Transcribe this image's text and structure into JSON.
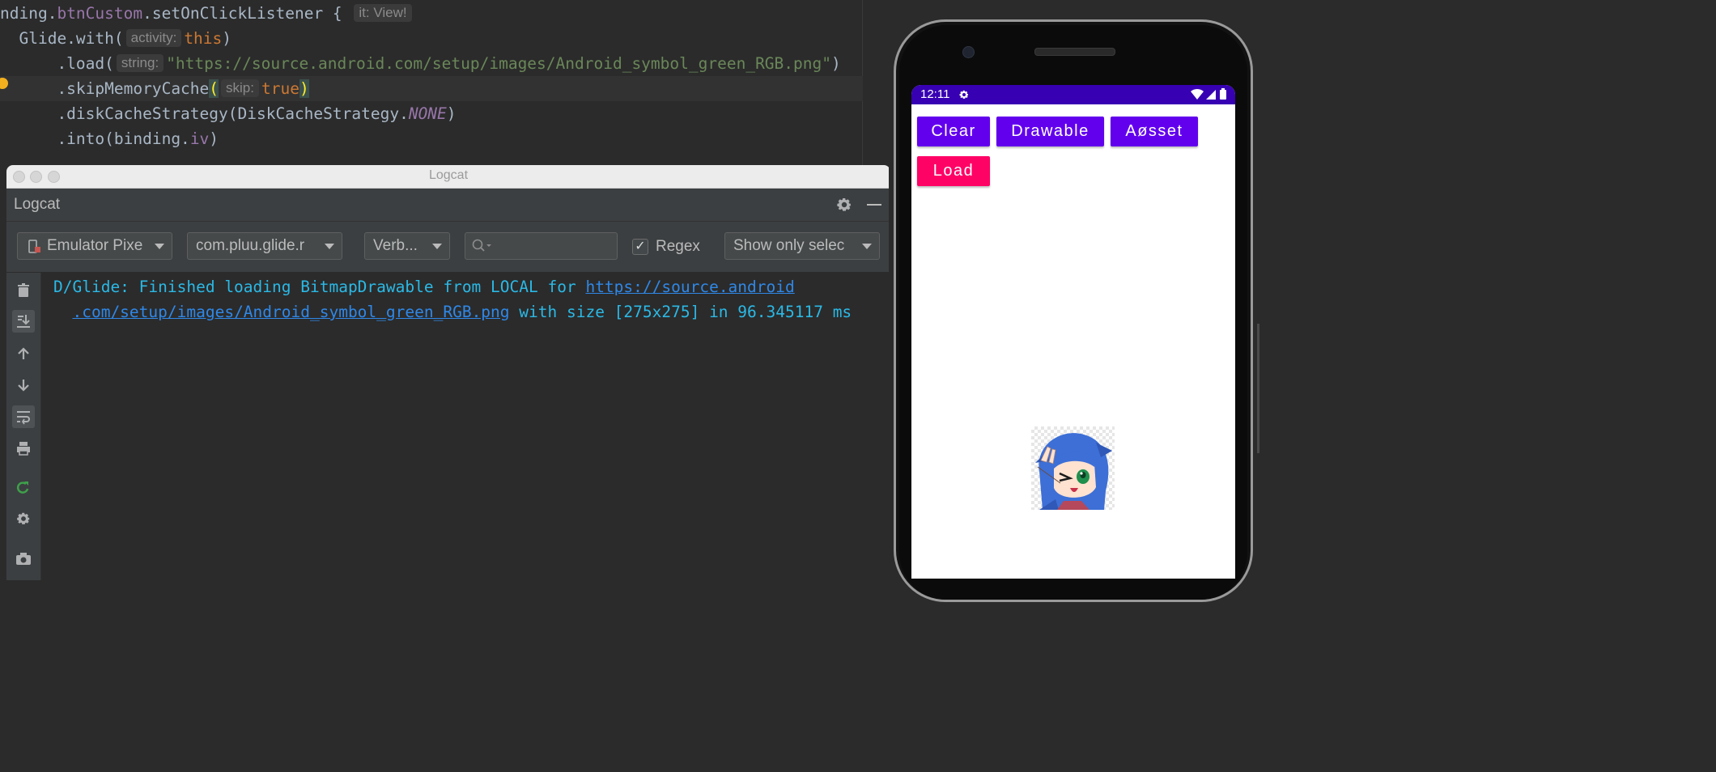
{
  "editor": {
    "lines": [
      {
        "parts": [
          {
            "t": "nding.",
            "c": "plain"
          },
          {
            "t": "btnCustom",
            "c": "purple"
          },
          {
            "t": ".setOnClickListener { ",
            "c": "plain"
          },
          {
            "hint": "it: View!"
          }
        ]
      },
      {
        "parts": [
          {
            "t": "  Glide.with(",
            "c": "plain"
          },
          {
            "hint": "activity:"
          },
          {
            "t": "this",
            "c": "orange"
          },
          {
            "t": ")",
            "c": "plain"
          }
        ]
      },
      {
        "parts": [
          {
            "t": "      .load(",
            "c": "plain"
          },
          {
            "hint": "string:"
          },
          {
            "t": "\"https://source.android.com/setup/images/Android_symbol_green_RGB.png\"",
            "c": "green"
          },
          {
            "t": ")",
            "c": "plain"
          }
        ]
      },
      {
        "parts": [
          {
            "t": "      .skipMemoryCache",
            "c": "plain"
          },
          {
            "t": "(",
            "c": "brace"
          },
          {
            "hint": "skip:"
          },
          {
            "t": "true",
            "c": "orange"
          },
          {
            "t": ")",
            "c": "brace"
          }
        ]
      },
      {
        "parts": [
          {
            "t": "      .diskCacheStrategy(DiskCacheStrategy.",
            "c": "plain"
          },
          {
            "t": "NONE",
            "c": "purple-italic"
          },
          {
            "t": ")",
            "c": "plain"
          }
        ]
      },
      {
        "parts": [
          {
            "t": "      .into(binding.",
            "c": "plain"
          },
          {
            "t": "iv",
            "c": "purple"
          },
          {
            "t": ")",
            "c": "plain"
          }
        ]
      }
    ]
  },
  "logcat": {
    "window_title": "Logcat",
    "panel_title": "Logcat",
    "device": "Emulator Pixe",
    "process": "com.pluu.glide.r",
    "level": "Verb...",
    "search": {
      "value": ""
    },
    "regex_label": "Regex",
    "regex_checked": true,
    "filter": "Show only selec",
    "output": {
      "line1_prefix": "D/Glide: Finished loading BitmapDrawable from LOCAL for ",
      "line1_link": "https://source.android",
      "line2_link": ".com/setup/images/Android_symbol_green_RGB.png",
      "line2_suffix": " with size [275x275] in 96.345117 ms"
    },
    "colors": {
      "log_text": "#2bb9e6",
      "link": "#2f88e8"
    }
  },
  "phone": {
    "status_time": "12:11",
    "buttons": {
      "clear": "Clear",
      "drawable": "Drawable",
      "asset": "Aøsset",
      "load": "Load"
    },
    "colors": {
      "primary": "#6200ee",
      "accent": "#ff0266",
      "status_bar": "#3700b3"
    }
  }
}
